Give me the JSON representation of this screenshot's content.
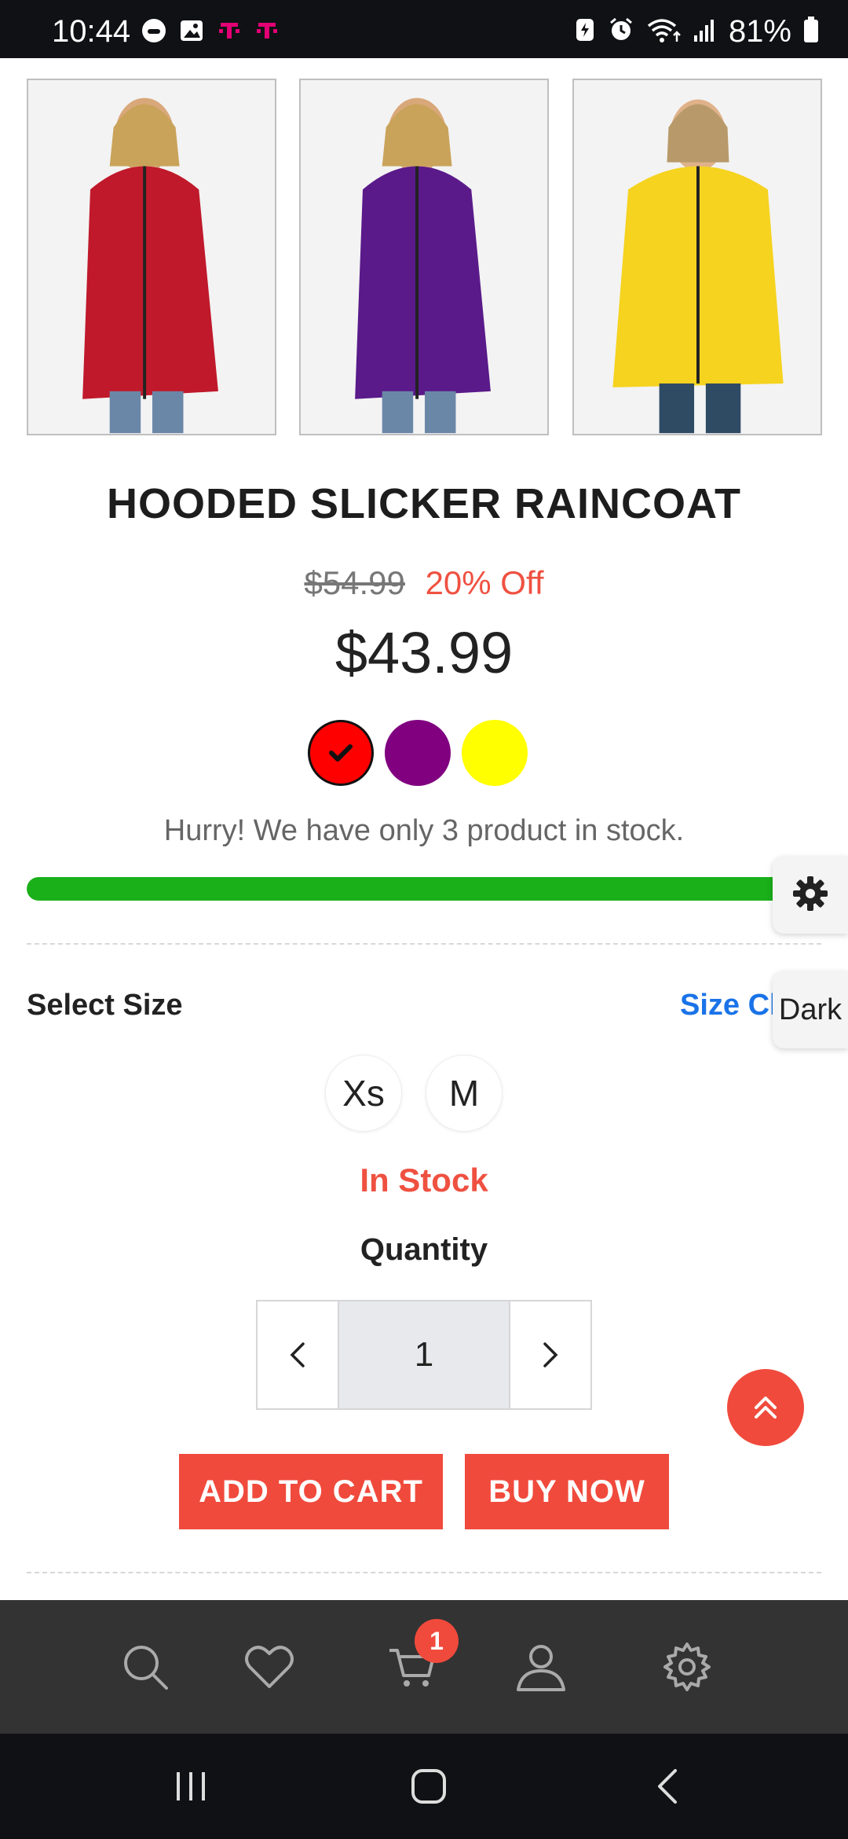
{
  "status_bar": {
    "time": "10:44",
    "battery": "81%",
    "left_icons": [
      "game-controller-icon",
      "gallery-icon",
      "tmobile-icon",
      "tmobile-icon"
    ],
    "right_icons": [
      "battery-saver-icon",
      "alarm-icon",
      "wifi-icon",
      "signal-icon",
      "battery-icon"
    ]
  },
  "product": {
    "title": "HOODED SLICKER RAINCOAT",
    "old_price": "$54.99",
    "discount": "20% Off",
    "price": "$43.99",
    "images": [
      {
        "color": "#c0192b"
      },
      {
        "color": "#5a1a8a"
      },
      {
        "color": "#f5d31f"
      }
    ],
    "swatches": [
      {
        "color": "#ff0000",
        "selected": true
      },
      {
        "color": "#800080",
        "selected": false
      },
      {
        "color": "#ffff00",
        "selected": false
      }
    ],
    "stock_message": "Hurry! We have only 3 product in stock.",
    "stock_progress": 1.0,
    "stock_status": "In Stock"
  },
  "size": {
    "label": "Select Size",
    "chart_link": "Size Cl",
    "options": [
      "Xs",
      "M"
    ]
  },
  "quantity": {
    "label": "Quantity",
    "value": "1"
  },
  "actions": {
    "add_to_cart": "ADD TO CART",
    "buy_now": "BUY NOW"
  },
  "side_panel": {
    "dark_label": "Dark"
  },
  "bottom_nav": {
    "items": [
      "search-icon",
      "heart-icon",
      "cart-icon",
      "user-icon",
      "settings-icon"
    ],
    "cart_count": "1"
  },
  "colors": {
    "accent": "#f04a3c",
    "progress": "#1ab01a",
    "link": "#1a73e8",
    "nav_bg": "#333333"
  }
}
